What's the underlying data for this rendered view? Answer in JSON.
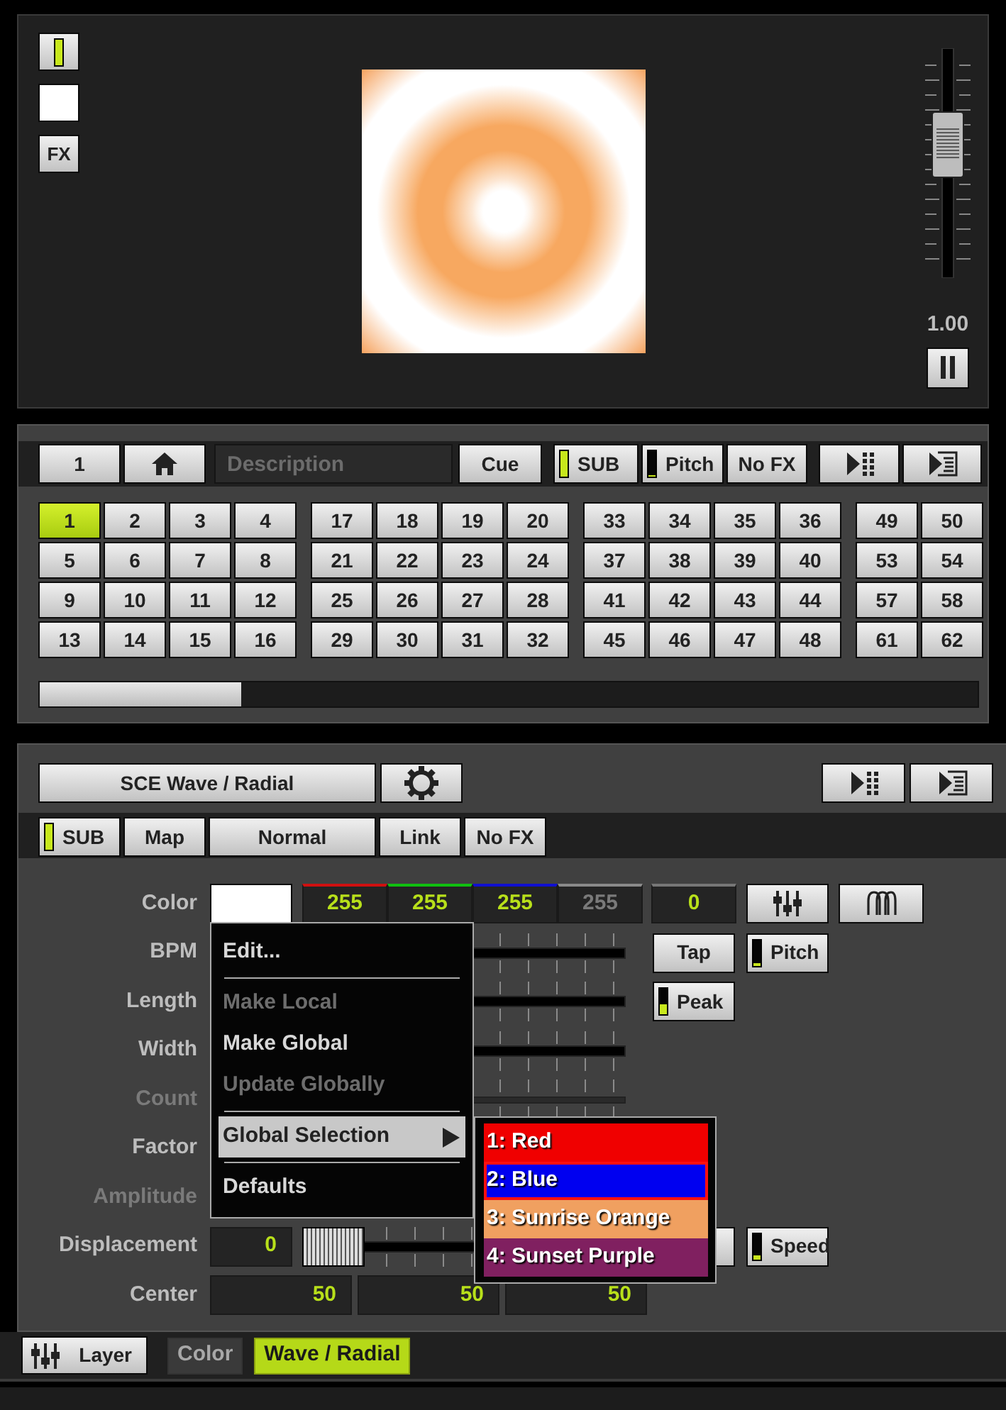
{
  "preview_panel": {
    "side_buttons": [
      {
        "kind": "indicator",
        "level": 1
      },
      {
        "kind": "swatch"
      },
      {
        "kind": "text",
        "label": "FX"
      }
    ],
    "fader": {
      "level": 0.62,
      "reading": "1.00"
    }
  },
  "cue_panel": {
    "toolbar": [
      {
        "kind": "text",
        "label": "1"
      },
      {
        "kind": "home"
      },
      {
        "kind": "field",
        "placeholder": "Description"
      },
      {
        "kind": "text",
        "label": "Cue"
      },
      {
        "kind": "indicator",
        "label": "SUB",
        "level": 1
      },
      {
        "kind": "indicator",
        "label": "Pitch",
        "level": 0.06
      },
      {
        "kind": "text",
        "label": "No FX"
      },
      {
        "kind": "play-list"
      },
      {
        "kind": "list"
      }
    ],
    "groups": [
      {
        "rows": [
          [
            {
              "label": "1",
              "selected": true
            },
            {
              "label": "2",
              "selected": false
            },
            {
              "label": "3",
              "selected": false
            },
            {
              "label": "4",
              "selected": false
            }
          ],
          [
            {
              "label": "5",
              "selected": false
            },
            {
              "label": "6",
              "selected": false
            },
            {
              "label": "7",
              "selected": false
            },
            {
              "label": "8",
              "selected": false
            }
          ],
          [
            {
              "label": "9",
              "selected": false
            },
            {
              "label": "10",
              "selected": false
            },
            {
              "label": "11",
              "selected": false
            },
            {
              "label": "12",
              "selected": false
            }
          ],
          [
            {
              "label": "13",
              "selected": false
            },
            {
              "label": "14",
              "selected": false
            },
            {
              "label": "15",
              "selected": false
            },
            {
              "label": "16",
              "selected": false
            }
          ]
        ]
      },
      {
        "rows": [
          [
            {
              "label": "17",
              "selected": false
            },
            {
              "label": "18",
              "selected": false
            },
            {
              "label": "19",
              "selected": false
            },
            {
              "label": "20",
              "selected": false
            }
          ],
          [
            {
              "label": "21",
              "selected": false
            },
            {
              "label": "22",
              "selected": false
            },
            {
              "label": "23",
              "selected": false
            },
            {
              "label": "24",
              "selected": false
            }
          ],
          [
            {
              "label": "25",
              "selected": false
            },
            {
              "label": "26",
              "selected": false
            },
            {
              "label": "27",
              "selected": false
            },
            {
              "label": "28",
              "selected": false
            }
          ],
          [
            {
              "label": "29",
              "selected": false
            },
            {
              "label": "30",
              "selected": false
            },
            {
              "label": "31",
              "selected": false
            },
            {
              "label": "32",
              "selected": false
            }
          ]
        ]
      },
      {
        "rows": [
          [
            {
              "label": "33",
              "selected": false
            },
            {
              "label": "34",
              "selected": false
            },
            {
              "label": "35",
              "selected": false
            },
            {
              "label": "36",
              "selected": false
            }
          ],
          [
            {
              "label": "37",
              "selected": false
            },
            {
              "label": "38",
              "selected": false
            },
            {
              "label": "39",
              "selected": false
            },
            {
              "label": "40",
              "selected": false
            }
          ],
          [
            {
              "label": "41",
              "selected": false
            },
            {
              "label": "42",
              "selected": false
            },
            {
              "label": "43",
              "selected": false
            },
            {
              "label": "44",
              "selected": false
            }
          ],
          [
            {
              "label": "45",
              "selected": false
            },
            {
              "label": "46",
              "selected": false
            },
            {
              "label": "47",
              "selected": false
            },
            {
              "label": "48",
              "selected": false
            }
          ]
        ]
      },
      {
        "rows": [
          [
            {
              "label": "49",
              "selected": false
            },
            {
              "label": "50",
              "selected": false
            }
          ],
          [
            {
              "label": "53",
              "selected": false
            },
            {
              "label": "54",
              "selected": false
            }
          ],
          [
            {
              "label": "57",
              "selected": false
            },
            {
              "label": "58",
              "selected": false
            }
          ],
          [
            {
              "label": "61",
              "selected": false
            },
            {
              "label": "62",
              "selected": false
            }
          ]
        ]
      }
    ]
  },
  "layer_panel": {
    "header": [
      {
        "kind": "title",
        "label": "SCE Wave / Radial"
      },
      {
        "kind": "gear"
      }
    ],
    "header_right": [
      {
        "kind": "play-list"
      },
      {
        "kind": "list"
      }
    ],
    "tabs": [
      {
        "kind": "indicator",
        "label": "SUB",
        "level": 1
      },
      {
        "kind": "text",
        "label": "Map"
      },
      {
        "kind": "wide",
        "label": "Normal"
      },
      {
        "kind": "text",
        "label": "Link"
      },
      {
        "kind": "text",
        "label": "No FX"
      }
    ],
    "color_row": {
      "label": "Color",
      "channels": [
        {
          "value": "255",
          "color": "#d01010",
          "active": true
        },
        {
          "value": "255",
          "color": "#10c010",
          "active": true
        },
        {
          "value": "255",
          "color": "#1010d0",
          "active": true
        },
        {
          "value": "255",
          "color": "#8a8a8a",
          "active": false
        }
      ],
      "extra": "0"
    },
    "params": [
      {
        "label": "BPM",
        "disabled": false,
        "kind": "slider",
        "buttons": [
          {
            "kind": "text",
            "label": "Tap"
          },
          {
            "kind": "indicator",
            "label": "Pitch",
            "level": 0.06
          }
        ]
      },
      {
        "label": "Length",
        "disabled": false,
        "kind": "slider",
        "buttons": [
          {
            "kind": "indicator",
            "label": "Peak",
            "level": 0.4
          }
        ]
      },
      {
        "label": "Width",
        "disabled": false,
        "kind": "slider"
      },
      {
        "label": "Count",
        "disabled": true,
        "kind": "slider"
      },
      {
        "label": "Factor",
        "disabled": false
      },
      {
        "label": "Amplitude",
        "disabled": true
      },
      {
        "label": "Displacement",
        "disabled": false,
        "kind": "value-slider",
        "value": "0",
        "level": 0,
        "buttons": [
          {
            "kind": "blank"
          },
          {
            "kind": "indicator",
            "label": "Speed",
            "level": 0.12
          }
        ]
      },
      {
        "label": "Center",
        "disabled": false,
        "kind": "fields",
        "values": [
          "50",
          "50",
          "50"
        ]
      }
    ]
  },
  "context_menu": {
    "items": [
      {
        "kind": "item",
        "label": "Edit...",
        "disabled": false,
        "selected": false,
        "submenu": false
      },
      {
        "kind": "separator"
      },
      {
        "kind": "item",
        "label": "Make Local",
        "disabled": true,
        "selected": false,
        "submenu": false
      },
      {
        "kind": "item",
        "label": "Make Global",
        "disabled": false,
        "selected": false,
        "submenu": false
      },
      {
        "kind": "item",
        "label": "Update Globally",
        "disabled": true,
        "selected": false,
        "submenu": false
      },
      {
        "kind": "separator"
      },
      {
        "kind": "item",
        "label": "Global Selection",
        "disabled": false,
        "selected": true,
        "submenu": true
      },
      {
        "kind": "separator"
      },
      {
        "kind": "item",
        "label": "Defaults",
        "disabled": false,
        "selected": false,
        "submenu": false
      }
    ]
  },
  "submenu": {
    "items": [
      {
        "label": "1: Red",
        "color": "#f00000",
        "selected": false
      },
      {
        "label": "2: Blue",
        "color": "#0000f0",
        "selected": true
      },
      {
        "label": "3: Sunrise Orange",
        "color": "#f0a060",
        "selected": false
      },
      {
        "label": "4: Sunset Purple",
        "color": "#802060",
        "selected": false
      }
    ]
  },
  "footer": [
    {
      "kind": "layer",
      "label": "Layer"
    },
    {
      "kind": "tab",
      "label": "Color",
      "selected": false
    },
    {
      "kind": "tab",
      "label": "Wave / Radial",
      "selected": true
    }
  ]
}
